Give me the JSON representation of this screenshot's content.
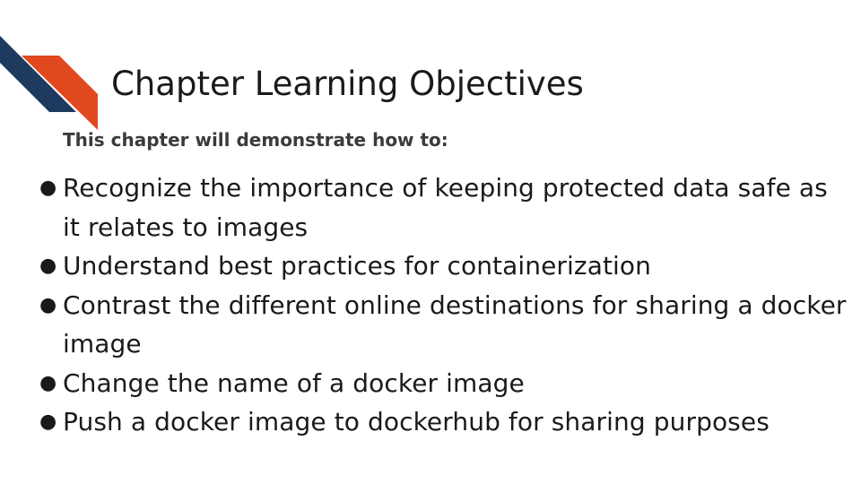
{
  "slide": {
    "title": "Chapter Learning Objectives",
    "subtitle": "This chapter will demonstrate how to:",
    "objectives": [
      "Recognize the importance of keeping protected data safe as it relates to images",
      "Understand best practices for containerization",
      "Contrast the different online destinations for sharing a docker image",
      "Change the name of a docker image",
      "Push a docker image to dockerhub for sharing purposes"
    ],
    "bullet_glyph": "●"
  },
  "colors": {
    "accent_navy": "#1f3a5f",
    "accent_orange": "#e0481e",
    "text": "#1a1a1a",
    "subtitle": "#3b3b3b"
  }
}
